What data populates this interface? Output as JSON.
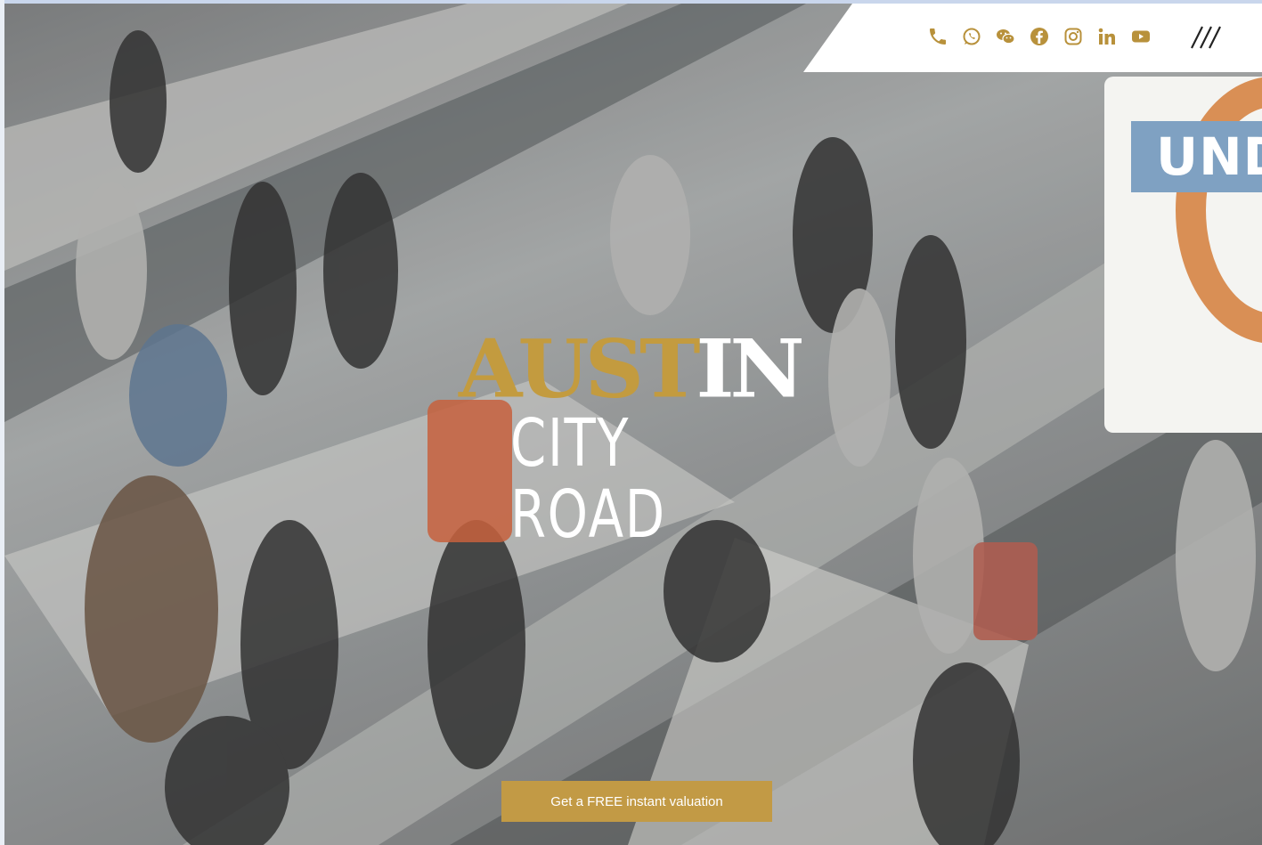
{
  "header": {
    "social_icons": [
      "phone-icon",
      "whatsapp-icon",
      "wechat-icon",
      "facebook-icon",
      "instagram-icon",
      "linkedin-icon",
      "youtube-icon"
    ],
    "menu_icon": "menu-slashes-icon",
    "icon_color": "#b8913b"
  },
  "hero": {
    "logo": {
      "line1_part1": "AUST",
      "line1_part2": "IN",
      "line2": "CITY ROAD"
    },
    "sign_text": "UND",
    "cta_label": "Get a FREE instant valuation"
  },
  "colors": {
    "gold": "#c39b3f",
    "cta": "#c29a45",
    "header_bg": "#ffffff"
  }
}
